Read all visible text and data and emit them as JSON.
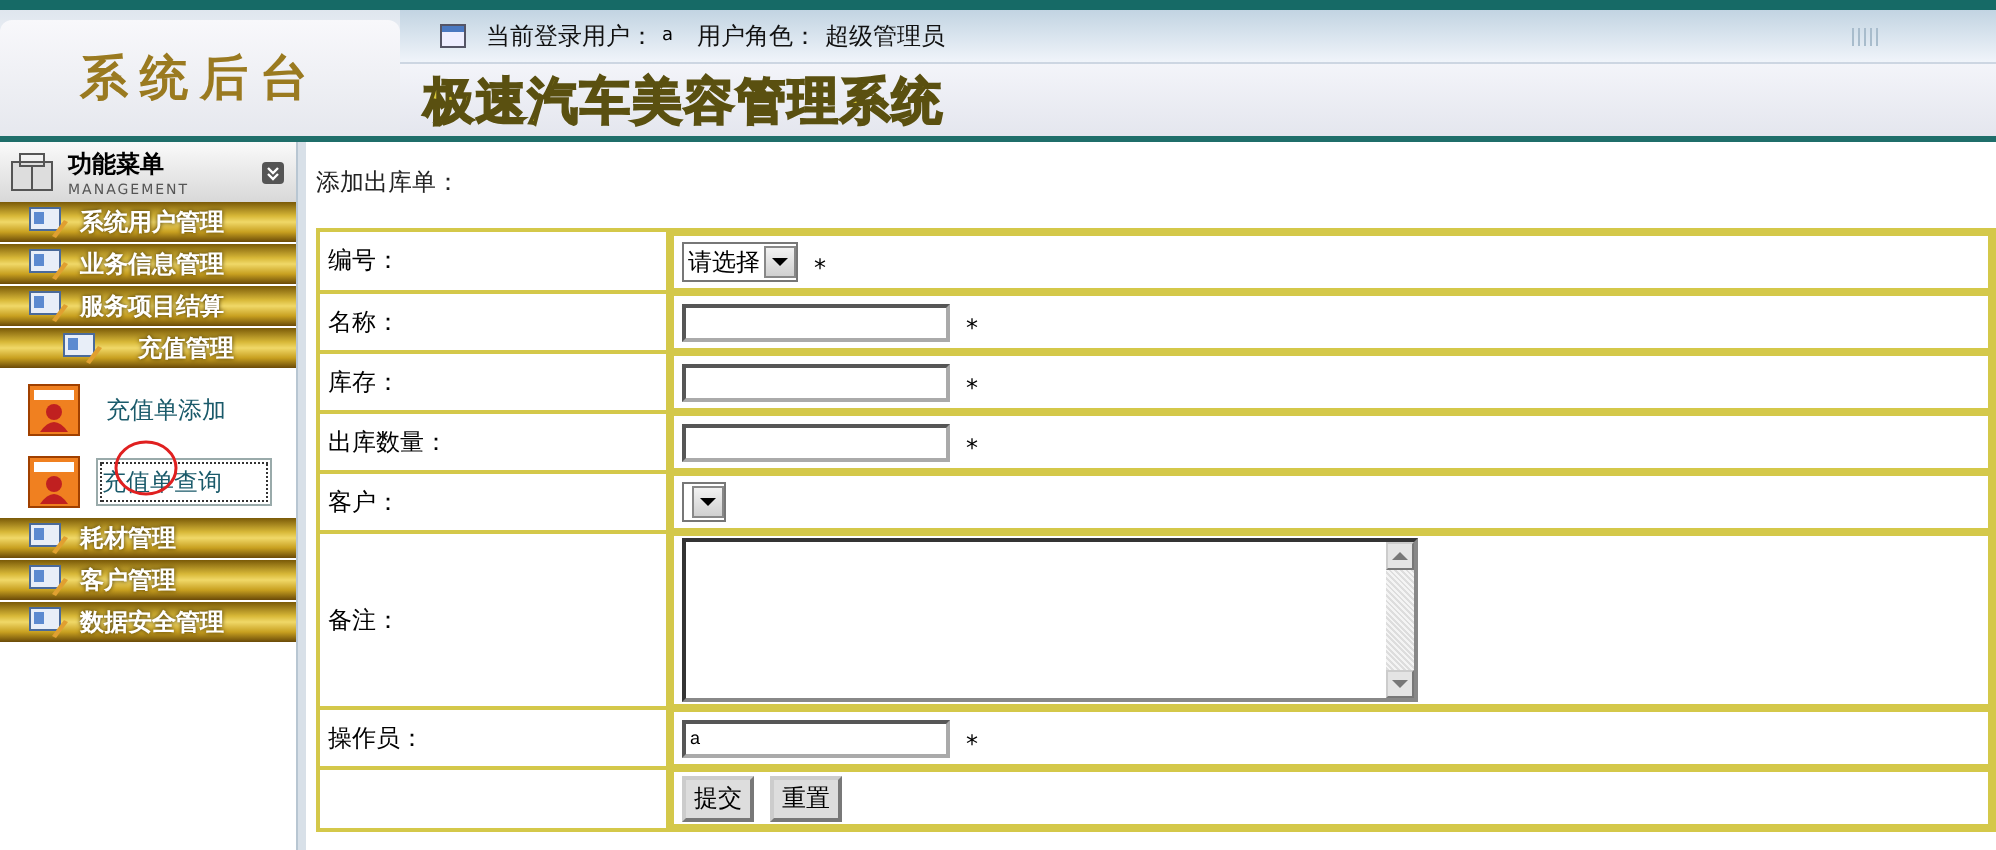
{
  "header": {
    "brand": "系统后台",
    "title": "极速汽车美容管理系统",
    "user_label": "当前登录用户：",
    "user": "a",
    "role_label": "用户角色：",
    "role": "超级管理员"
  },
  "sidebar": {
    "title": "功能菜单",
    "subtitle": "MANAGEMENT",
    "items": [
      {
        "label": "系统用户管理",
        "expanded": false
      },
      {
        "label": "业务信息管理",
        "expanded": false
      },
      {
        "label": "服务项目结算",
        "expanded": false
      },
      {
        "label": "充值管理",
        "expanded": true,
        "children": [
          {
            "label": "充值单添加",
            "selected": false
          },
          {
            "label": "充值单查询",
            "selected": true
          }
        ]
      },
      {
        "label": "耗材管理",
        "expanded": false
      },
      {
        "label": "客户管理",
        "expanded": false
      },
      {
        "label": "数据安全管理",
        "expanded": false
      }
    ]
  },
  "form": {
    "heading": "添加出库单：",
    "rows": [
      {
        "kind": "select",
        "label": "编号：",
        "value": "请选择",
        "marker": "*"
      },
      {
        "kind": "text",
        "label": "名称：",
        "value": "",
        "marker": "*"
      },
      {
        "kind": "text",
        "label": "库存：",
        "value": "",
        "marker": "*"
      },
      {
        "kind": "text",
        "label": "出库数量：",
        "value": "",
        "marker": "*"
      },
      {
        "kind": "select",
        "label": "客户：",
        "value": ""
      },
      {
        "kind": "textarea",
        "label": "备注：",
        "value": ""
      },
      {
        "kind": "text",
        "label": "操作员：",
        "value": "a",
        "marker": "*"
      },
      {
        "kind": "buttons",
        "buttons": [
          "提交",
          "重置"
        ]
      }
    ]
  }
}
